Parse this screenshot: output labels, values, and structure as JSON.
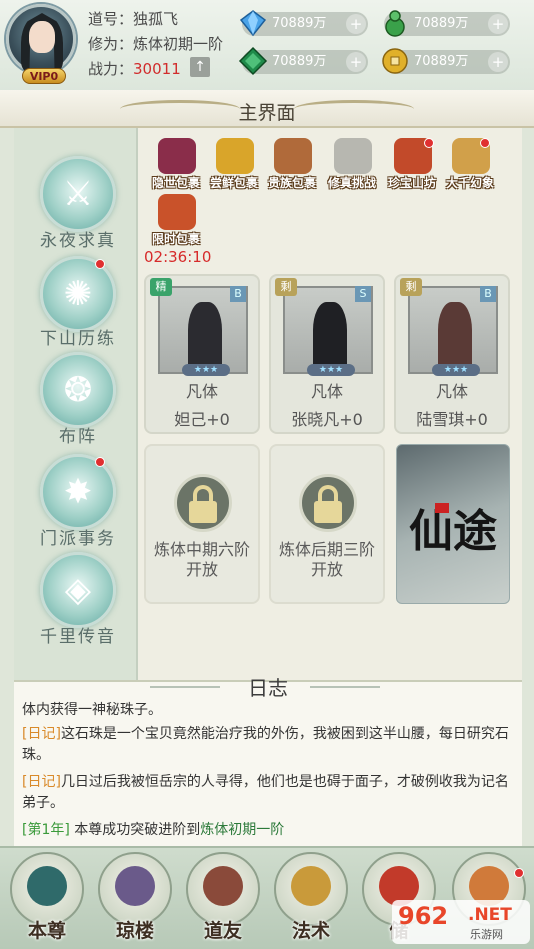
{
  "profile": {
    "dao_label": "道号：",
    "dao_name": "独孤飞",
    "cult_label": "修为：",
    "cult_value": "炼体初期一阶",
    "power_label": "战力：",
    "power_value": "30011",
    "vip": "VIP0"
  },
  "currencies": [
    {
      "value": "70889万",
      "icon": "blue-gem-icon",
      "color": "#3a8fd8"
    },
    {
      "value": "70889万",
      "icon": "green-gourd-icon",
      "color": "#3aa14a"
    },
    {
      "value": "70889万",
      "icon": "green-jade-icon",
      "color": "#1f8a4a"
    },
    {
      "value": "70889万",
      "icon": "gold-coin-icon",
      "color": "#d6a21e"
    }
  ],
  "title": "主界面",
  "sidebar": [
    {
      "label": "永夜求真",
      "icon": "warrior-helmet-icon",
      "dot": false
    },
    {
      "label": "下山历练",
      "icon": "wings-emblem-icon",
      "dot": true
    },
    {
      "label": "布阵",
      "icon": "formation-scroll-icon",
      "dot": false
    },
    {
      "label": "门派事务",
      "icon": "flower-star-icon",
      "dot": true
    },
    {
      "label": "千里传音",
      "icon": "lotus-eye-icon",
      "dot": false
    }
  ],
  "top_icons": [
    {
      "label": "隐世包裹",
      "icon": "purple-bag-icon",
      "color": "#8a2d4a",
      "dot": false
    },
    {
      "label": "尝鲜包裹",
      "icon": "gold-ingot-icon",
      "color": "#d9a52a",
      "dot": false
    },
    {
      "label": "贵族包裹",
      "icon": "brown-bag-icon",
      "color": "#b06a3a",
      "dot": false
    },
    {
      "label": "修真挑战",
      "icon": "crossed-swords-icon",
      "color": "#b7b7b0",
      "dot": false
    },
    {
      "label": "珍宝山坊",
      "icon": "fortune-house-icon",
      "color": "#c24a2a",
      "dot": true
    },
    {
      "label": "大千幻象",
      "icon": "golden-scroll-icon",
      "color": "#d1a04a",
      "dot": true
    },
    {
      "label": "限时包裹",
      "icon": "orange-bag-icon",
      "color": "#c9522a",
      "dot": false
    }
  ],
  "timer": "02:36:10",
  "characters": [
    {
      "badge": "精",
      "badge_color": "#3aa36a",
      "tier": "B",
      "t1": "凡体",
      "t2": "妲己+0",
      "fig_color": "#2b2b30"
    },
    {
      "badge": "剩",
      "badge_color": "#b8a25a",
      "tier": "S",
      "t1": "凡体",
      "t2": "张晓凡+0",
      "fig_color": "#1f2024"
    },
    {
      "badge": "剩",
      "badge_color": "#b8a25a",
      "tier": "B",
      "t1": "凡体",
      "t2": "陆雪琪+0",
      "fig_color": "#5a3a36"
    }
  ],
  "locked": [
    {
      "line1": "炼体中期六阶",
      "line2": "开放"
    },
    {
      "line1": "炼体后期三阶",
      "line2": "开放"
    }
  ],
  "banner_text": "仙途",
  "log": {
    "title": "日志",
    "entries": [
      {
        "tag": "",
        "text": "体内获得一神秘珠子。"
      },
      {
        "tag": "[日记]",
        "text": "这石珠是一个宝贝竟然能治疗我的外伤，我被困到这半山腰，每日研究石珠。"
      },
      {
        "tag": "[日记]",
        "text": "几日过后我被恒岳宗的人寻得，他们也是也碍于面子，才破例收我为记名弟子。"
      },
      {
        "tag": "[第1年]",
        "text_a": " 本尊成功突破进阶到",
        "text_b": "炼体初期一阶"
      }
    ]
  },
  "nav": [
    {
      "label": "本尊",
      "icon": "chibi-hero-icon",
      "color": "#2f6a6a"
    },
    {
      "label": "琼楼",
      "icon": "pavilion-icon",
      "color": "#6a5a8a"
    },
    {
      "label": "道友",
      "icon": "friend-portrait-icon",
      "color": "#8a4a3a"
    },
    {
      "label": "法术",
      "icon": "golden-lotus-icon",
      "color": "#c99a3a"
    },
    {
      "label": "储",
      "icon": "red-pouch-icon",
      "color": "#c23a2a"
    },
    {
      "label": "",
      "icon": "shop-scroll-icon",
      "color": "#d07a3a"
    }
  ],
  "watermark": {
    "number": "962",
    "suffix": ".NET",
    "site": "乐游网"
  }
}
